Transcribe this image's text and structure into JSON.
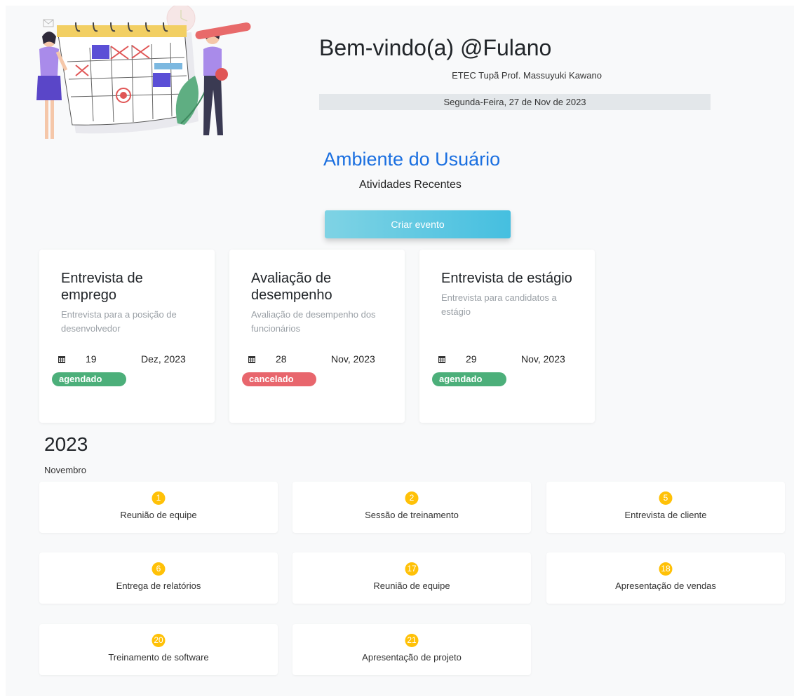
{
  "header": {
    "welcome": "Bem-vindo(a) @Fulano",
    "school": "ETEC Tupã Prof. Massuyuki Kawano",
    "date": "Segunda-Feira, 27 de Nov de 2023"
  },
  "environment": {
    "title": "Ambiente do Usuário",
    "subtitle": "Atividades Recentes",
    "create_button": "Criar evento"
  },
  "cards": [
    {
      "title": "Entrevista de emprego",
      "description": "Entrevista para a posição de desenvolvedor",
      "day": "19",
      "month": "Dez, 2023",
      "status": "agendado",
      "status_color": "#4caf7a"
    },
    {
      "title": "Avaliação de desempenho",
      "description": "Avaliação de desempenho dos funcionários",
      "day": "28",
      "month": "Nov, 2023",
      "status": "cancelado",
      "status_color": "#e8666d"
    },
    {
      "title": "Entrevista de estágio",
      "description": "Entrevista para candidatos a estágio",
      "day": "29",
      "month": "Nov, 2023",
      "status": "agendado",
      "status_color": "#4caf7a"
    }
  ],
  "calendar": {
    "year": "2023",
    "month": "Novembro",
    "events": [
      {
        "day": "1",
        "label": "Reunião de equipe"
      },
      {
        "day": "2",
        "label": "Sessão de treinamento"
      },
      {
        "day": "5",
        "label": "Entrevista de cliente"
      },
      {
        "day": "6",
        "label": "Entrega de relatórios"
      },
      {
        "day": "17",
        "label": "Reunião de equipe"
      },
      {
        "day": "18",
        "label": "Apresentação de vendas"
      },
      {
        "day": "20",
        "label": "Treinamento de software"
      },
      {
        "day": "21",
        "label": "Apresentação de projeto"
      }
    ]
  },
  "colors": {
    "accent": "#1a6fe0",
    "badge": "#ffc107",
    "button_start": "#7fd3e4",
    "button_end": "#45bfe0"
  }
}
